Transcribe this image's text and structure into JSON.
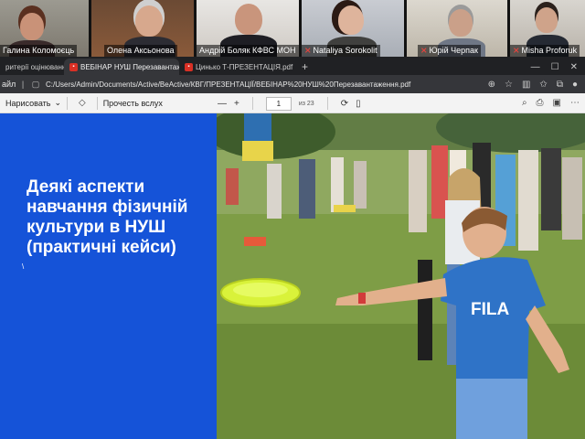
{
  "meeting": {
    "participants": [
      {
        "name": "Галина Коломоєць",
        "muted": false
      },
      {
        "name": "Олена Аксьонова",
        "muted": false
      },
      {
        "name": "Андрій Боляк КФВС МОН",
        "muted": false
      },
      {
        "name": "Nataliya Sorokolit",
        "muted": true
      },
      {
        "name": "Юрій Черпак",
        "muted": true
      },
      {
        "name": "Misha Proforuk",
        "muted": true
      }
    ]
  },
  "browser": {
    "tabs": [
      {
        "label": "ритерії оцінюванн",
        "active": false
      },
      {
        "label": "ВЕБІНАР НУШ Перезавантаження",
        "active": true
      },
      {
        "label": "Цинько Т-ПРЕЗЕНТАЦІЯ.pdf",
        "active": false
      }
    ],
    "address_prefix": "айл",
    "url": "C:/Users/Admin/Documents/Active/BeActive/КВГ/ПРЕЗЕНТАЦІЇ/ВЕБІНАР%20НУШ%20Перезавантаження.pdf"
  },
  "pdf_toolbar": {
    "draw_label": "Нарисовать",
    "read_aloud_label": "Прочесть вслух",
    "page_current": "1",
    "page_total": "из 23"
  },
  "slide": {
    "title": "Деякі аспекти навчання фізичній культури в НУШ (практичні кейси)",
    "cursor_glyph": "\\",
    "photo_jersey_text": "FILA",
    "colors": {
      "panel": "#1553d8",
      "frisbee": "#d9f23a"
    }
  }
}
